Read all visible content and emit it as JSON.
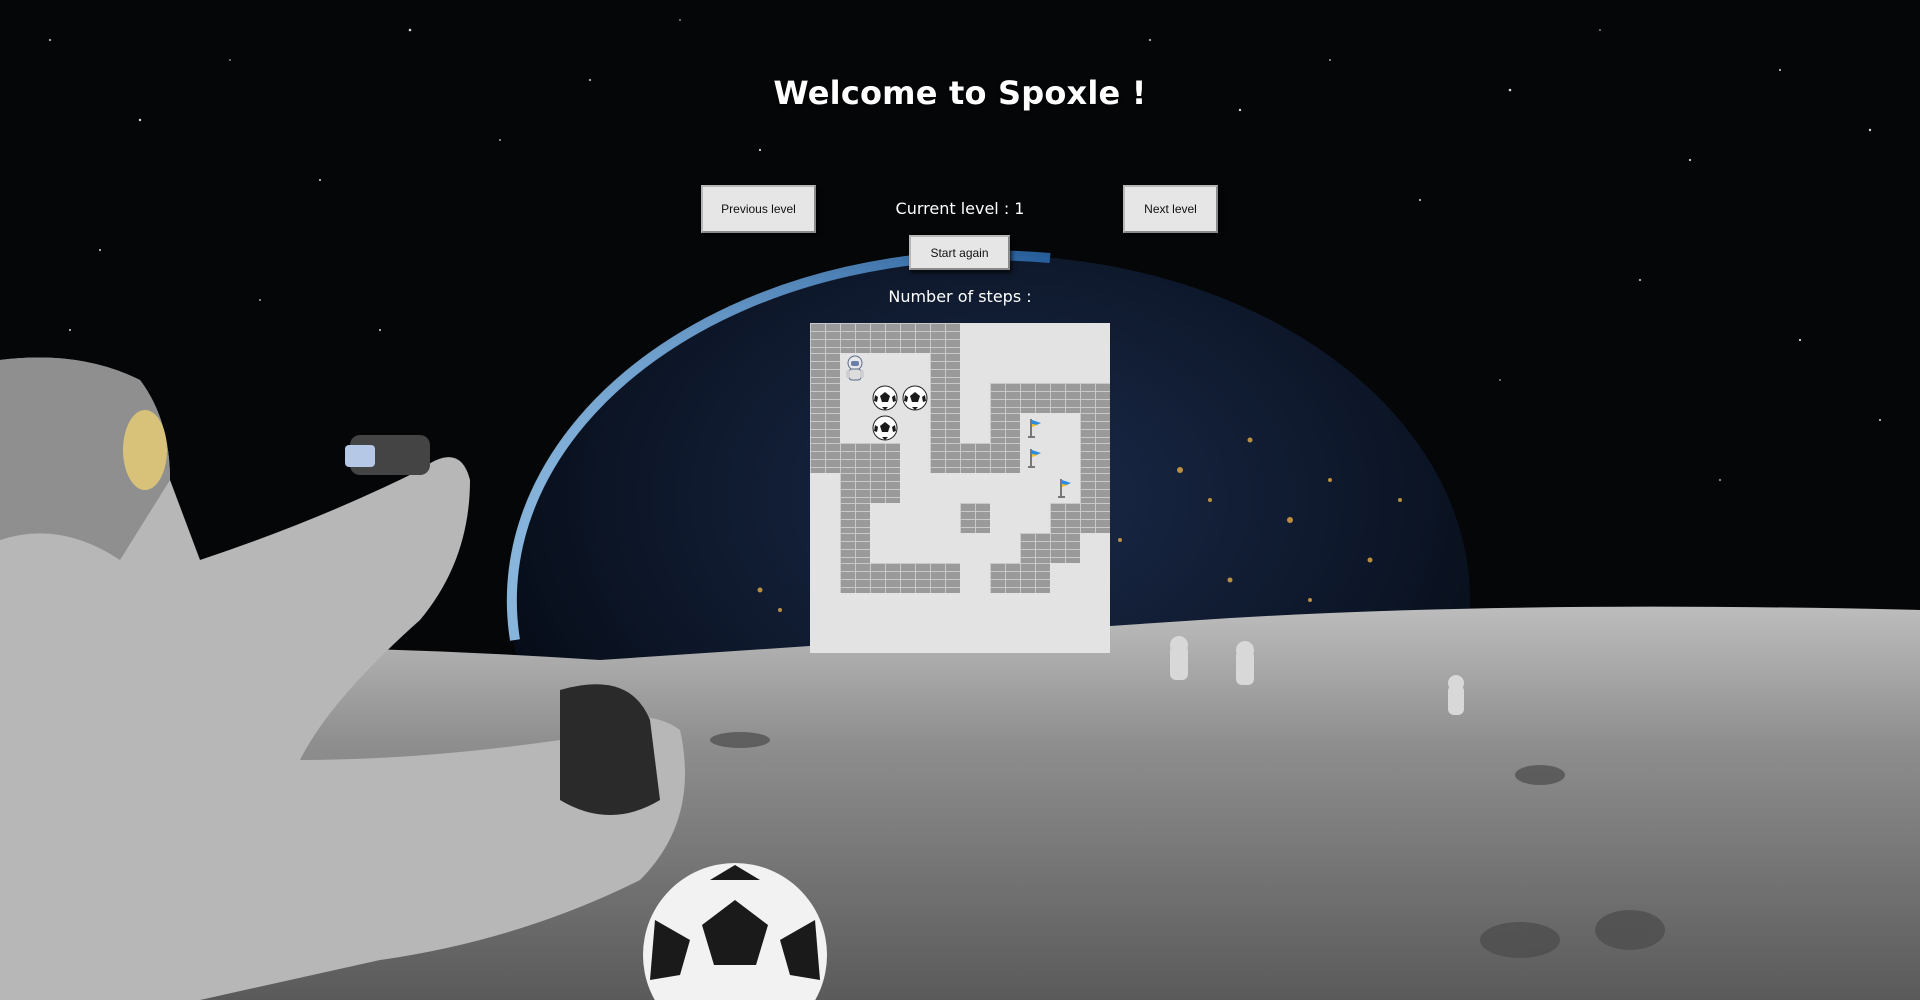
{
  "header": {
    "title": "Welcome to Spoxle !"
  },
  "controls": {
    "previous_label": "Previous level",
    "next_label": "Next level",
    "restart_label": "Start again",
    "current_level_text": "Current level : 1",
    "steps_text": "Number of steps :"
  },
  "game": {
    "level": 1,
    "grid_cols": 10,
    "grid_rows": 11,
    "map": [
      "WWWWW.....",
      "WP..W.....",
      "W.BBW.WWWW",
      "W.B.W.WT.W",
      "WWW.WWWT.W",
      ".WW.....TW",
      ".W...W..WW",
      ".W.....WW.",
      ".WWWW.WW..",
      "..........",
      ".........."
    ],
    "legend": {
      "W": "wall",
      "P": "astronaut-player",
      "B": "soccer-ball",
      "T": "flag-target",
      ".": "floor"
    }
  },
  "colors": {
    "board_floor": "#e3e3e3",
    "wall": "#9a9a9a",
    "button_bg": "#e6e6e6",
    "text": "#ffffff"
  }
}
